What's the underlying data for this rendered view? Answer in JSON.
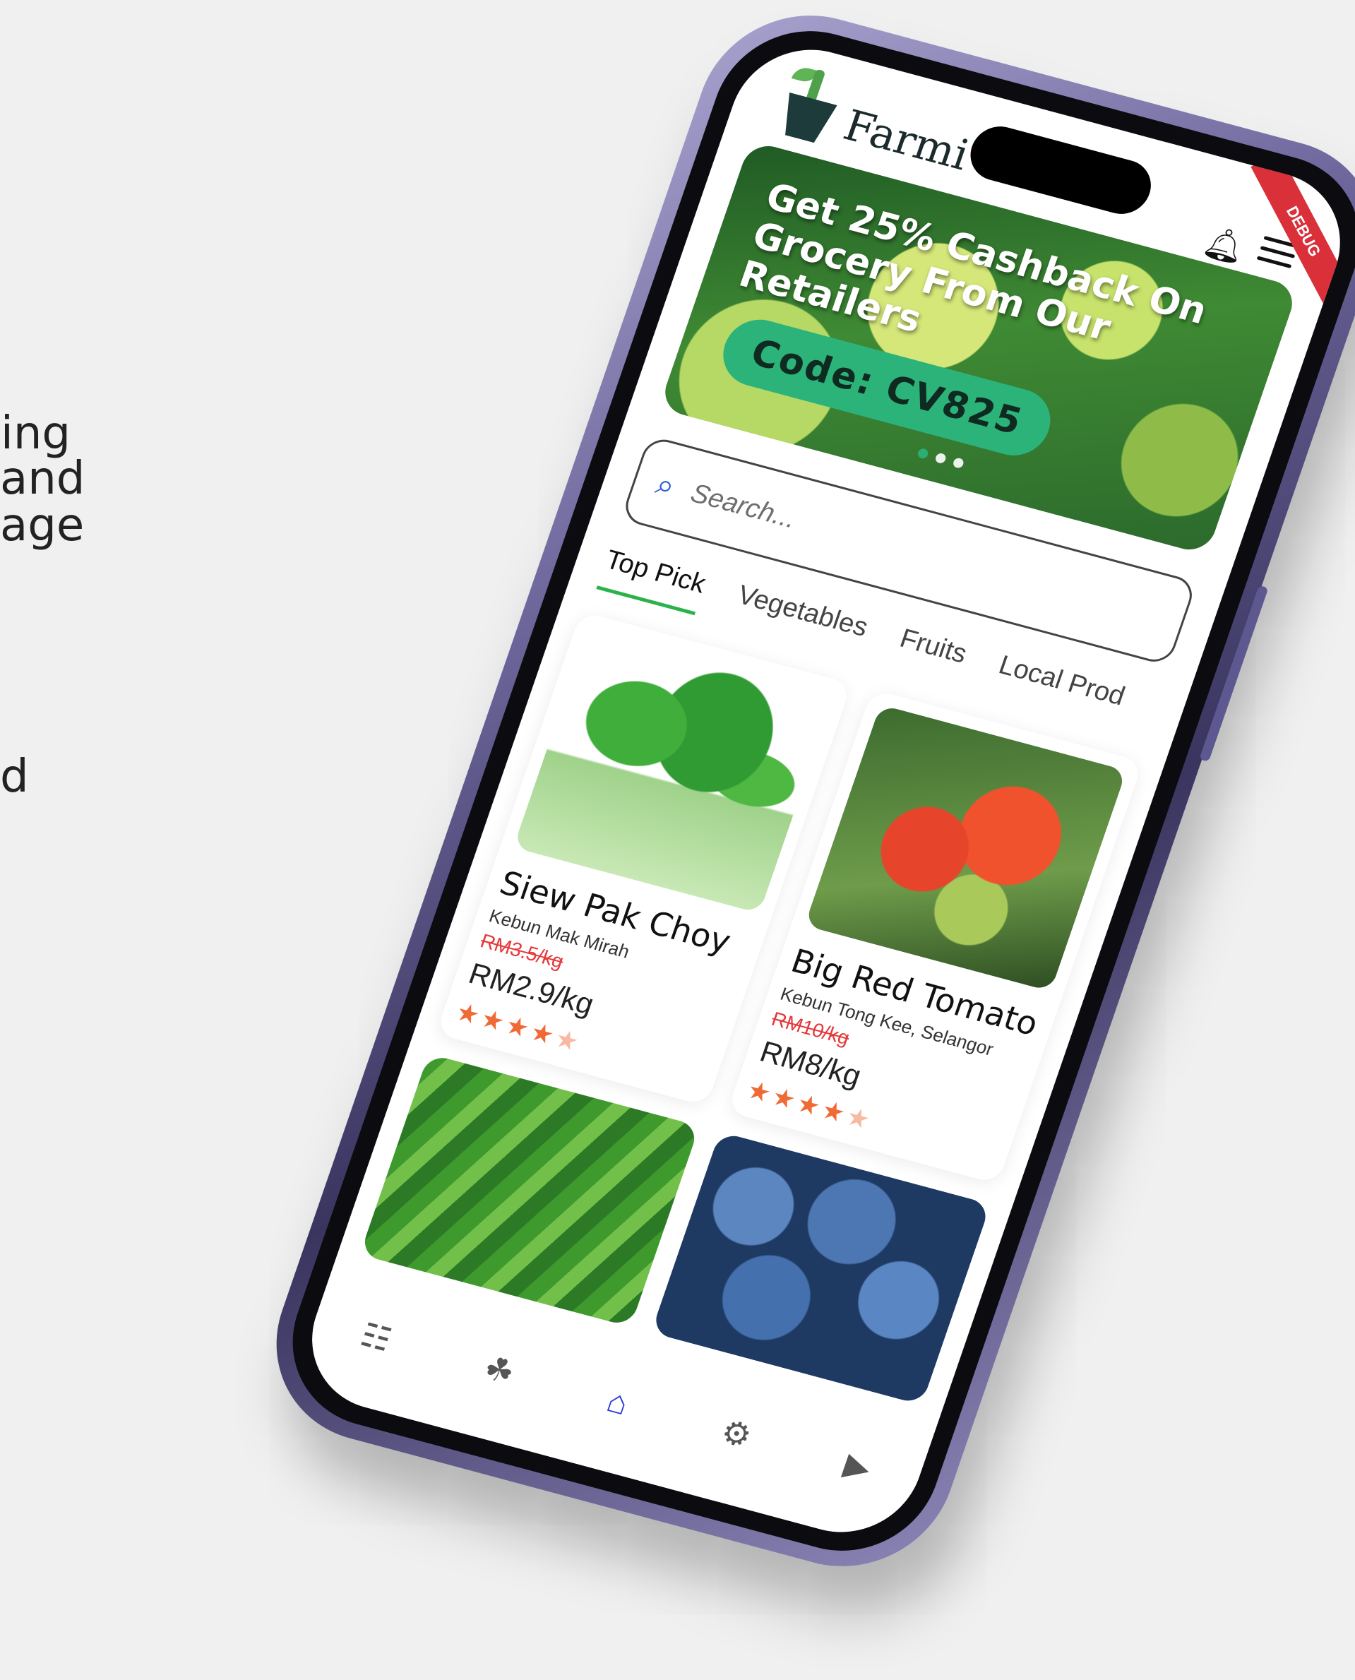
{
  "side_text": [
    "ing",
    "and",
    "age",
    "d"
  ],
  "app": {
    "brand": "Farmi",
    "debug_label": "DEBUG"
  },
  "banner": {
    "title": "Get 25% Cashback On Grocery From Our Retailers",
    "code": "Code: CV825"
  },
  "search": {
    "placeholder": "Search..."
  },
  "tabs": [
    {
      "label": "Top Pick"
    },
    {
      "label": "Vegetables"
    },
    {
      "label": "Fruits"
    },
    {
      "label": "Local Prod"
    }
  ],
  "products": [
    {
      "name": "Siew Pak Choy",
      "farm": "Kebun Mak Mirah",
      "old_price": "RM3.5/kg",
      "price": "RM2.9/kg",
      "rating": 4
    },
    {
      "name": "Big Red Tomato",
      "farm": "Kebun Tong Kee, Selangor",
      "old_price": "RM10/kg",
      "price": "RM8/kg",
      "rating": 4
    }
  ],
  "colors": {
    "accent": "#2bb34a",
    "code_bg": "#2bb37a",
    "sale": "#e5393b",
    "star": "#ef6a35",
    "nav_active": "#2b3bd9"
  },
  "icons": {
    "bell": "bell-icon",
    "menu": "hamburger-menu-icon",
    "search": "search-icon",
    "nav": [
      "stats-icon",
      "plant-icon",
      "home-icon",
      "robot-icon",
      "video-icon"
    ]
  }
}
